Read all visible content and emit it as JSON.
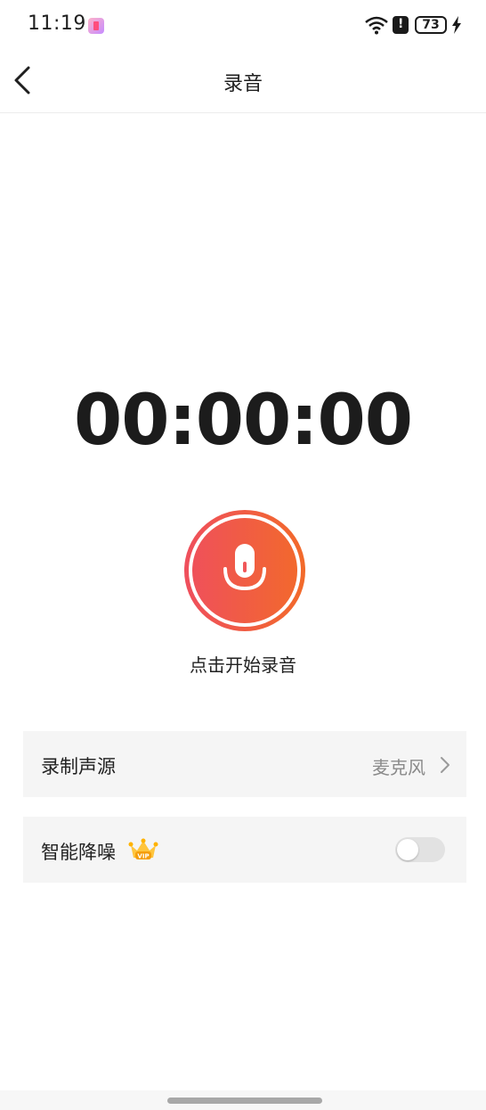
{
  "status_bar": {
    "time": "11:19",
    "battery": "73"
  },
  "header": {
    "title": "录音"
  },
  "timer": {
    "value": "00:00:00"
  },
  "record": {
    "hint": "点击开始录音"
  },
  "settings": {
    "source": {
      "label": "录制声源",
      "value": "麦克风"
    },
    "noise_reduction": {
      "label": "智能降噪",
      "badge": "VIP",
      "enabled": false
    }
  },
  "colors": {
    "record_gradient_start": "#ef4f5d",
    "record_gradient_end": "#f26a2a"
  }
}
